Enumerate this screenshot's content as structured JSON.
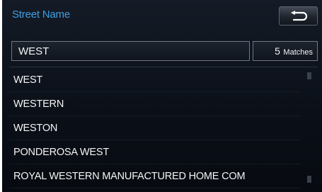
{
  "header": {
    "title": "Street Name",
    "back_icon": "back-arrow-icon"
  },
  "search": {
    "value": "WEST"
  },
  "results": {
    "count": "5",
    "count_label": "Matches",
    "items": [
      "WEST",
      "WESTERN",
      "WESTON",
      "PONDEROSA WEST",
      "ROYAL WESTERN MANUFACTURED HOME COM"
    ]
  },
  "colors": {
    "title": "#3f9fe0",
    "background": "#0b1019",
    "text": "#f4f4f4"
  }
}
